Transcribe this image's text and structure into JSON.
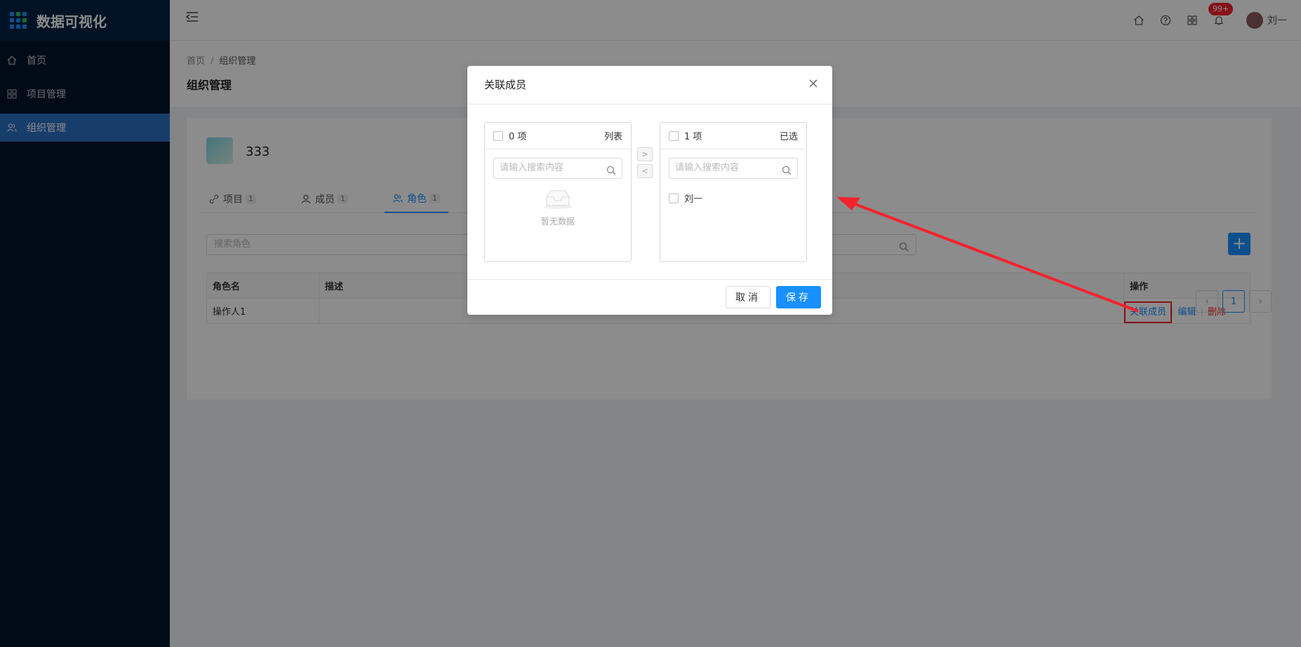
{
  "brand": {
    "title": "数据可视化"
  },
  "sidebar": {
    "items": [
      {
        "label": "首页",
        "icon": "home-icon"
      },
      {
        "label": "项目管理",
        "icon": "grid-icon"
      },
      {
        "label": "组织管理",
        "icon": "users-icon",
        "active": true
      }
    ]
  },
  "header": {
    "notification_count": "99+",
    "user_name": "刘一"
  },
  "breadcrumb": {
    "home": "首页",
    "current": "组织管理"
  },
  "page": {
    "title": "组织管理"
  },
  "org": {
    "name": "333"
  },
  "tabs": [
    {
      "label": "项目",
      "count": "1"
    },
    {
      "label": "成员",
      "count": "1"
    },
    {
      "label": "角色",
      "count": "1",
      "active": true
    }
  ],
  "search": {
    "placeholder": "搜索角色"
  },
  "table": {
    "headers": {
      "name": "角色名",
      "desc": "描述",
      "ops": "操作"
    },
    "rows": [
      {
        "name": "操作人1",
        "desc": "",
        "ops": [
          "关联成员",
          "编辑",
          "删除"
        ]
      }
    ]
  },
  "pagination": {
    "current": "1"
  },
  "modal": {
    "title": "关联成员",
    "left": {
      "count": "0 项",
      "title": "列表",
      "search_placeholder": "请输入搜索内容",
      "empty": "暂无数据"
    },
    "right": {
      "count": "1 项",
      "title": "已选",
      "search_placeholder": "请输入搜索内容",
      "items": [
        "刘一"
      ]
    },
    "cancel": "取消",
    "save": "保存"
  },
  "colors": {
    "primary": "#1890ff",
    "sidebar": "#00142a",
    "danger": "#f5222d"
  }
}
